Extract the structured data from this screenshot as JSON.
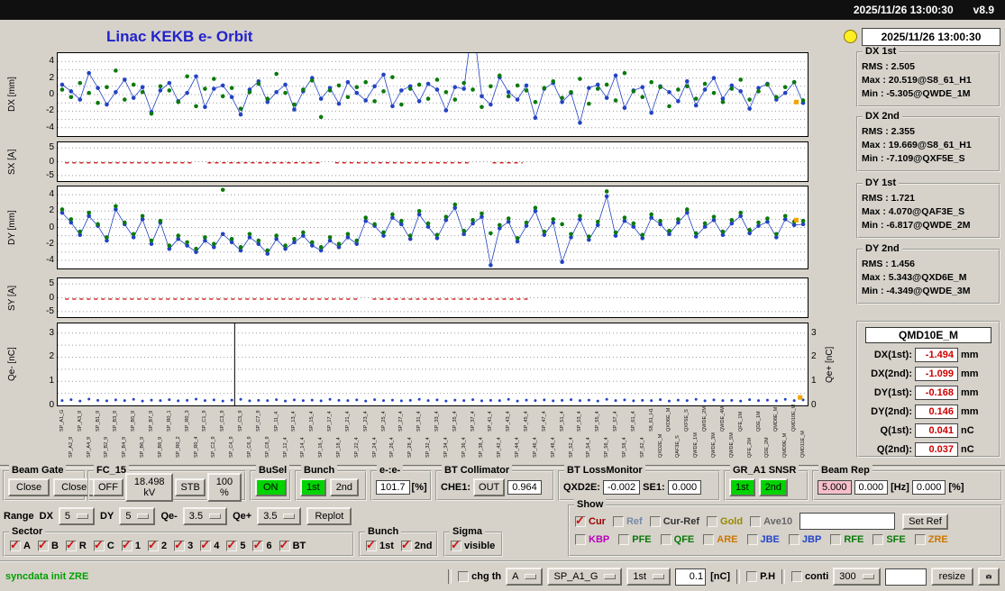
{
  "titlebar": {
    "clock": "2025/11/26 13:00:30",
    "version": "v8.9"
  },
  "title": "Linac KEKB e- Orbit",
  "colors": {
    "green_on": "#00d400",
    "pink_selected": "#f6bfc8",
    "red_value": "#cc0000",
    "title_blue": "#2222cc",
    "status_green": "#00a000",
    "lamp_yellow": "#ffee22",
    "series_blue": "#2343c3",
    "series_green": "#0a7a0a",
    "series_red": "#cc0000",
    "series_orange": "#f0a500"
  },
  "side": {
    "timestamp": "2025/11/26 13:00:30",
    "stats": [
      {
        "name": "DX 1st",
        "rms": "RMS : 2.505",
        "max": "Max : 20.519@S8_61_H1",
        "min": "Min : -5.305@QWDE_1M"
      },
      {
        "name": "DX 2nd",
        "rms": "RMS : 2.355",
        "max": "Max : 19.669@S8_61_H1",
        "min": "Min : -7.109@QXF5E_S"
      },
      {
        "name": "DY 1st",
        "rms": "RMS : 1.721",
        "max": "Max : 4.070@QAF3E_S",
        "min": "Min : -6.817@QWDE_2M"
      },
      {
        "name": "DY 2nd",
        "rms": "RMS : 1.456",
        "max": "Max : 5.343@QXD6E_M",
        "min": "Min : -4.349@QWDE_3M"
      }
    ],
    "monitor": {
      "title": "QMD10E_M",
      "rows": [
        {
          "label": "DX(1st):",
          "value": "-1.494",
          "unit": "mm"
        },
        {
          "label": "DX(2nd):",
          "value": "-1.099",
          "unit": "mm"
        },
        {
          "label": "DY(1st):",
          "value": "-0.168",
          "unit": "mm"
        },
        {
          "label": "DY(2nd):",
          "value": "0.146",
          "unit": "mm"
        },
        {
          "label": "Q(1st):",
          "value": "0.041",
          "unit": "nC"
        },
        {
          "label": "Q(2nd):",
          "value": "0.037",
          "unit": "nC"
        }
      ]
    }
  },
  "charts": [
    {
      "name": "dx",
      "ylabel": "DX [mm]",
      "ylim": [
        -5,
        5
      ],
      "ticks": [
        4,
        2,
        0,
        -2,
        -4
      ],
      "grid_step": 1,
      "series": [
        {
          "name": "dx-2nd-bunch",
          "color": "#2343c3",
          "line": true,
          "marker": true,
          "r": 2.3,
          "values": [
            1.2,
            0.4,
            -0.6,
            2.6,
            0.8,
            -1.2,
            0.3,
            1.8,
            -0.4,
            0.9,
            -2.1,
            0.5,
            1.4,
            -0.8,
            0.2,
            2.2,
            -1.5,
            0.7,
            1.1,
            -0.3,
            -2.4,
            0.6,
            1.6,
            -0.9,
            0.3,
            1.2,
            -1.8,
            0.4,
            2.0,
            -0.5,
            0.8,
            -1.1,
            1.5,
            0.2,
            -0.7,
            1.0,
            2.4,
            -1.4,
            0.5,
            1.0,
            -0.8,
            1.3,
            0.6,
            -1.9,
            0.9,
            0.7,
            9.0,
            -0.2,
            -1.2,
            2.1,
            0.3,
            -0.6,
            1.1,
            -2.8,
            0.7,
            1.4,
            -0.9,
            0.2,
            -3.4,
            0.8,
            1.2,
            -0.4,
            2.3,
            -1.6,
            0.5,
            0.9,
            -2.2,
            1.0,
            0.3,
            -0.8,
            1.6,
            -1.3,
            0.6,
            2.0,
            -0.5,
            1.1,
            0.4,
            -1.7,
            0.8,
            1.3,
            -0.6,
            0.2,
            1.5,
            -1.0
          ]
        },
        {
          "name": "dx-1st-bunch",
          "color": "#0a7a0a",
          "line": false,
          "marker": true,
          "r": 2.3,
          "values": [
            0.6,
            -0.3,
            1.4,
            0.2,
            -1.0,
            0.9,
            2.9,
            -0.6,
            1.2,
            0.3,
            -2.3,
            1.0,
            0.5,
            -0.9,
            2.2,
            -1.4,
            0.7,
            1.9,
            -0.2,
            0.8,
            -1.7,
            0.3,
            1.3,
            -0.5,
            2.5,
            0.2,
            -1.2,
            0.6,
            1.7,
            -2.7,
            0.5,
            1.1,
            -0.3,
            0.9,
            1.5,
            -0.8,
            0.4,
            2.1,
            -1.2,
            0.7,
            1.2,
            -0.5,
            1.8,
            0.3,
            -0.6,
            1.4,
            0.6,
            -1.5,
            1.0,
            2.3,
            -0.2,
            1.1,
            0.5,
            -0.9,
            0.8,
            1.6,
            -0.4,
            0.3,
            1.9,
            -1.1,
            0.7,
            1.2,
            -0.7,
            2.6,
            0.4,
            -0.3,
            1.5,
            0.9,
            -1.4,
            0.6,
            1.0,
            -0.5,
            1.3,
            0.2,
            -0.9,
            0.7,
            1.8,
            -0.6,
            0.4,
            1.2,
            -0.3,
            0.9,
            1.5,
            -0.7
          ]
        },
        {
          "name": "dx-end-marker",
          "color": "#f0a500",
          "marker": true,
          "square": true,
          "points": [
            [
              0.985,
              -0.9
            ]
          ]
        }
      ]
    },
    {
      "name": "sx",
      "ylabel": "SX [A]",
      "ylim": [
        -7,
        7
      ],
      "ticks": [
        5,
        0,
        -5
      ],
      "grid_step": 5,
      "series": [
        {
          "name": "sx-steering",
          "color": "#cc0000",
          "dash": true,
          "segments": [
            [
              0.01,
              0.18,
              -0.4
            ],
            [
              0.2,
              0.35,
              -0.4
            ],
            [
              0.37,
              0.55,
              -0.4
            ],
            [
              0.58,
              0.62,
              -0.4
            ]
          ]
        }
      ]
    },
    {
      "name": "dy",
      "ylabel": "DY [mm]",
      "ylim": [
        -5,
        5
      ],
      "ticks": [
        4,
        2,
        0,
        -2,
        -4
      ],
      "grid_step": 1,
      "series": [
        {
          "name": "dy-2nd-bunch",
          "color": "#2343c3",
          "line": true,
          "marker": true,
          "r": 2.3,
          "values": [
            1.8,
            0.6,
            -0.9,
            1.4,
            0.2,
            -1.6,
            2.2,
            0.4,
            -1.2,
            1.0,
            -2.0,
            0.6,
            -2.6,
            -1.4,
            -2.2,
            -3.0,
            -1.6,
            -2.4,
            -0.8,
            -1.8,
            -2.8,
            -1.2,
            -2.0,
            -3.2,
            -1.4,
            -2.6,
            -1.8,
            -1.0,
            -2.2,
            -2.8,
            -1.6,
            -2.4,
            -1.2,
            -2.0,
            0.8,
            0.2,
            -1.0,
            1.2,
            0.4,
            -1.4,
            1.6,
            0.1,
            -1.3,
            0.9,
            2.4,
            -0.8,
            0.5,
            1.3,
            -4.6,
            -0.1,
            0.7,
            -1.7,
            0.2,
            2.0,
            -0.9,
            0.6,
            -4.2,
            -1.2,
            1.0,
            -1.5,
            0.3,
            3.8,
            -1.0,
            0.8,
            0.1,
            -1.3,
            1.2,
            0.4,
            -0.8,
            0.6,
            1.8,
            -1.1,
            0.1,
            0.9,
            -0.9,
            0.5,
            1.4,
            -0.7,
            0.2,
            0.7,
            -1.2,
            1.0,
            0.3,
            0.4
          ]
        },
        {
          "name": "dy-1st-bunch",
          "color": "#0a7a0a",
          "line": false,
          "marker": true,
          "r": 2.3,
          "values": [
            2.2,
            1.0,
            -0.5,
            1.8,
            0.4,
            -1.2,
            2.6,
            0.6,
            -0.8,
            1.4,
            -1.6,
            0.8,
            -2.2,
            -1.0,
            -1.8,
            -2.6,
            -1.2,
            -2.0,
            4.6,
            -1.4,
            -2.4,
            -0.8,
            -1.6,
            -2.8,
            -1.0,
            -2.2,
            -1.4,
            -0.6,
            -1.8,
            -2.4,
            -1.2,
            -2.0,
            -0.8,
            -1.6,
            1.2,
            0.4,
            -0.6,
            1.6,
            0.8,
            -1.0,
            2.0,
            0.5,
            -0.9,
            1.3,
            2.8,
            -0.4,
            0.9,
            1.7,
            -0.7,
            0.3,
            1.1,
            -1.3,
            0.6,
            2.4,
            -0.5,
            1.0,
            0.4,
            -0.8,
            1.4,
            -1.1,
            0.7,
            4.4,
            -0.6,
            1.2,
            0.5,
            -0.9,
            1.6,
            0.8,
            -0.4,
            1.0,
            2.2,
            -0.7,
            0.5,
            1.3,
            -0.5,
            0.9,
            1.8,
            -0.3,
            0.6,
            1.1,
            -0.8,
            1.4,
            0.7,
            0.8
          ]
        },
        {
          "name": "dy-end-marker",
          "color": "#f0a500",
          "marker": true,
          "square": true,
          "points": [
            [
              0.985,
              0.9
            ]
          ]
        }
      ]
    },
    {
      "name": "sy",
      "ylabel": "SY [A]",
      "ylim": [
        -7,
        7
      ],
      "ticks": [
        5,
        0,
        -5
      ],
      "grid_step": 5,
      "series": [
        {
          "name": "sy-steering",
          "color": "#cc0000",
          "dash": true,
          "segments": [
            [
              0.01,
              0.4,
              -0.5
            ],
            [
              0.42,
              0.63,
              -0.5
            ]
          ]
        }
      ]
    },
    {
      "name": "qe",
      "ylabel": "Qe- [nC]",
      "ylabel_right": "Qe+ [nC]",
      "ylim": [
        0,
        3.4
      ],
      "ticks": [
        3,
        2,
        1,
        0
      ],
      "right_ticks": true,
      "grid_step": 0.5,
      "vlines": [
        {
          "x": 0.236,
          "color": "#000000"
        }
      ],
      "series": [
        {
          "name": "qe-minus-charge",
          "color": "#2343c3",
          "line": false,
          "marker": true,
          "r": 1.5,
          "values": [
            0.2,
            0.24,
            0.18,
            0.26,
            0.21,
            0.19,
            0.23,
            0.2,
            0.25,
            0.18,
            0.22,
            0.2,
            0.24,
            0.19,
            0.21,
            0.26,
            0.2,
            0.23,
            0.18,
            0.22,
            0.25,
            0.19,
            0.21,
            0.2,
            0.24,
            0.18,
            0.23,
            0.2,
            0.22,
            0.19,
            0.25,
            0.21,
            0.2,
            0.23,
            0.18,
            0.24,
            0.2,
            0.22,
            0.19,
            0.21,
            0.25,
            0.2,
            0.23,
            0.18,
            0.22,
            0.2,
            0.24,
            0.19,
            0.21,
            0.2,
            0.25,
            0.18,
            0.22,
            0.2,
            0.23,
            0.19,
            0.21,
            0.24,
            0.2,
            0.22,
            0.18,
            0.25,
            0.2,
            0.23,
            0.19,
            0.21,
            0.2,
            0.24,
            0.18,
            0.22,
            0.2,
            0.25,
            0.19,
            0.23,
            0.2,
            0.21,
            0.18,
            0.24,
            0.2,
            0.22,
            0.19,
            0.25,
            0.2,
            0.23
          ]
        },
        {
          "name": "qe-plus-charge",
          "color": "#f0a500",
          "marker": true,
          "square": true,
          "points": [
            [
              0.99,
              0.33
            ]
          ]
        }
      ]
    }
  ],
  "xlabels": [
    "SP_A1_G",
    "SP_A2_9",
    "SP_A3_9",
    "SP_A4_9",
    "SP_B1_9",
    "SP_B2_9",
    "SP_B3_9",
    "SP_B4_9",
    "SP_B5_9",
    "SP_B6_9",
    "SP_B7_9",
    "SP_B8_9",
    "SP_R0_1",
    "SP_R0_2",
    "SP_R0_3",
    "SP_R0_4",
    "SP_C1_9",
    "SP_C2_9",
    "SP_C3_9",
    "SP_C4_9",
    "SP_C5_9",
    "SP_C6_9",
    "SP_C7_9",
    "SP_C8_9",
    "SP_11_4",
    "SP_12_4",
    "SP_13_4",
    "SP_14_4",
    "SP_15_4",
    "SP_16_4",
    "SP_17_4",
    "SP_18_4",
    "SP_21_4",
    "SP_22_4",
    "SP_23_4",
    "SP_24_4",
    "SP_25_4",
    "SP_26_4",
    "SP_27_4",
    "SP_28_4",
    "SP_31_4",
    "SP_32_4",
    "SP_33_4",
    "SP_34_4",
    "SP_35_4",
    "SP_36_4",
    "SP_37_4",
    "SP_38_4",
    "SP_41_4",
    "SP_42_4",
    "SP_43_4",
    "SP_44_4",
    "SP_45_4",
    "SP_46_4",
    "SP_47_4",
    "SP_48_4",
    "SP_51_4",
    "SP_52_4",
    "SP_53_4",
    "SP_54_4",
    "SP_55_4",
    "SP_56_4",
    "SP_57_4",
    "SP_58_4",
    "SP_61_4",
    "SP_62_4",
    "S8_61_H1",
    "QXD2E_M",
    "QXD6E_M",
    "QAF3E_S",
    "QXF5E_S",
    "QWDE_1M",
    "QWDE_2M",
    "QWDE_3M",
    "QWDE_4M",
    "QWDE_5M",
    "QFE_1M",
    "QFE_2M",
    "QDE_1M",
    "QDE_2M",
    "QMD8E_M",
    "QMD9E_M",
    "QMD10E_M",
    "QMD11E_M"
  ],
  "panels": {
    "beam_gate": {
      "title": "Beam Gate",
      "btn1": "Close",
      "btn2": "Close"
    },
    "fc15": {
      "title": "FC_15",
      "off": "OFF",
      "kv": "18.498 kV",
      "stb": "STB",
      "pct": "100 %"
    },
    "busel": {
      "title": "BuSel",
      "on": "ON"
    },
    "bunch": {
      "title": "Bunch",
      "b1": "1st",
      "b2": "2nd"
    },
    "ee": {
      "title": "e-:e-",
      "value": "101.7",
      "unit": "[%]"
    },
    "bt_collimator": {
      "title": "BT Collimator",
      "che1_label": "CHE1:",
      "che1": "OUT",
      "value": "0.964"
    },
    "bt_loss": {
      "title": "BT LossMonitor",
      "l1": "QXD2E:",
      "v1": "-0.002",
      "l2": "SE1:",
      "v2": "0.000"
    },
    "gr_snsr": {
      "title": "GR_A1 SNSR",
      "b1": "1st",
      "b2": "2nd"
    },
    "beam_rep": {
      "title": "Beam Rep",
      "v1": "5.000",
      "v2": "0.000",
      "u1": "[Hz]",
      "v3": "0.000",
      "u2": "[%]"
    },
    "range": {
      "label": "Range",
      "dx_label": "DX",
      "dx": "5",
      "dy_label": "DY",
      "dy": "5",
      "qem_label": "Qe-",
      "qem": "3.5",
      "qep_label": "Qe+",
      "qep": "3.5",
      "replot": "Replot"
    },
    "show": {
      "title": "Show",
      "row1": [
        {
          "label": "Cur",
          "checked": true,
          "color": "#990000"
        },
        {
          "label": "Ref",
          "checked": false,
          "color": "#7788aa"
        },
        {
          "label": "Cur-Ref",
          "checked": false,
          "color": "#333333"
        },
        {
          "label": "Gold",
          "checked": false,
          "color": "#998800"
        },
        {
          "label": "Ave10",
          "checked": false,
          "color": "#666666"
        }
      ],
      "set_ref": "Set Ref",
      "row2": [
        {
          "label": "KBP",
          "checked": false,
          "color": "#bb00bb"
        },
        {
          "label": "PFE",
          "checked": false,
          "color": "#0a7a0a"
        },
        {
          "label": "QFE",
          "checked": false,
          "color": "#0a7a0a"
        },
        {
          "label": "ARE",
          "checked": false,
          "color": "#cc7700"
        },
        {
          "label": "JBE",
          "checked": false,
          "color": "#2244cc"
        },
        {
          "label": "JBP",
          "checked": false,
          "color": "#2244cc"
        },
        {
          "label": "RFE",
          "checked": false,
          "color": "#0a7a0a"
        },
        {
          "label": "SFE",
          "checked": false,
          "color": "#0a7a0a"
        },
        {
          "label": "ZRE",
          "checked": false,
          "color": "#cc7700"
        }
      ]
    },
    "sector": {
      "title": "Sector",
      "items": [
        {
          "label": "A",
          "checked": true
        },
        {
          "label": "B",
          "checked": true
        },
        {
          "label": "R",
          "checked": true
        },
        {
          "label": "C",
          "checked": true
        },
        {
          "label": "1",
          "checked": true
        },
        {
          "label": "2",
          "checked": true
        },
        {
          "label": "3",
          "checked": true
        },
        {
          "label": "4",
          "checked": true
        },
        {
          "label": "5",
          "checked": true
        },
        {
          "label": "6",
          "checked": true
        },
        {
          "label": "BT",
          "checked": true
        }
      ]
    },
    "bunch_sel": {
      "title": "Bunch",
      "items": [
        {
          "label": "1st",
          "checked": true
        },
        {
          "label": "2nd",
          "checked": true
        }
      ]
    },
    "sigma": {
      "title": "Sigma",
      "items": [
        {
          "label": "visible",
          "checked": true
        }
      ]
    }
  },
  "statusbar": {
    "message": "syncdata init ZRE",
    "chg_th": "chg th",
    "sel_a": "A",
    "sel_sp": "SP_A1_G",
    "sel_bunch": "1st",
    "thresh": "0.1",
    "unit": "[nC]",
    "ph": "P.H",
    "conti": "conti",
    "num": "300",
    "resize": "resize"
  }
}
